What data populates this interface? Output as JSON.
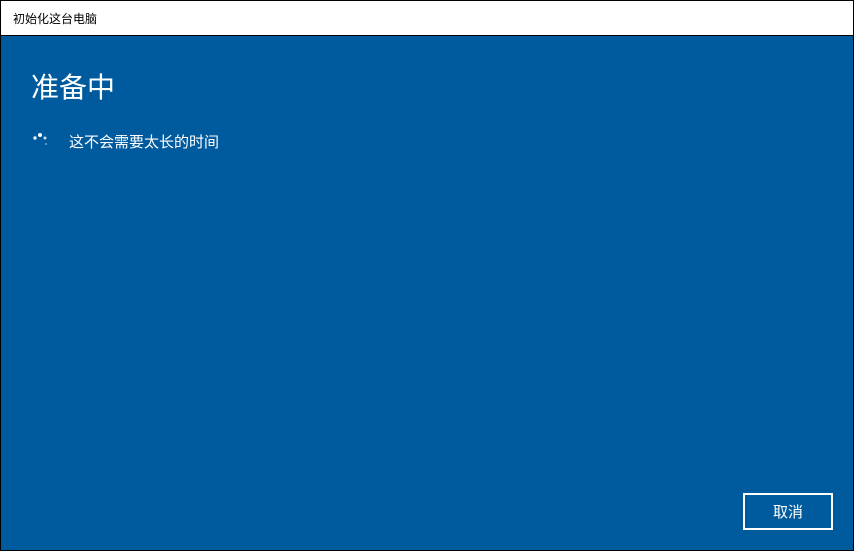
{
  "window": {
    "title": "初始化这台电脑"
  },
  "main": {
    "heading": "准备中",
    "status_text": "这不会需要太长的时间"
  },
  "footer": {
    "cancel_label": "取消"
  },
  "colors": {
    "background": "#005a9e",
    "text": "#ffffff"
  }
}
